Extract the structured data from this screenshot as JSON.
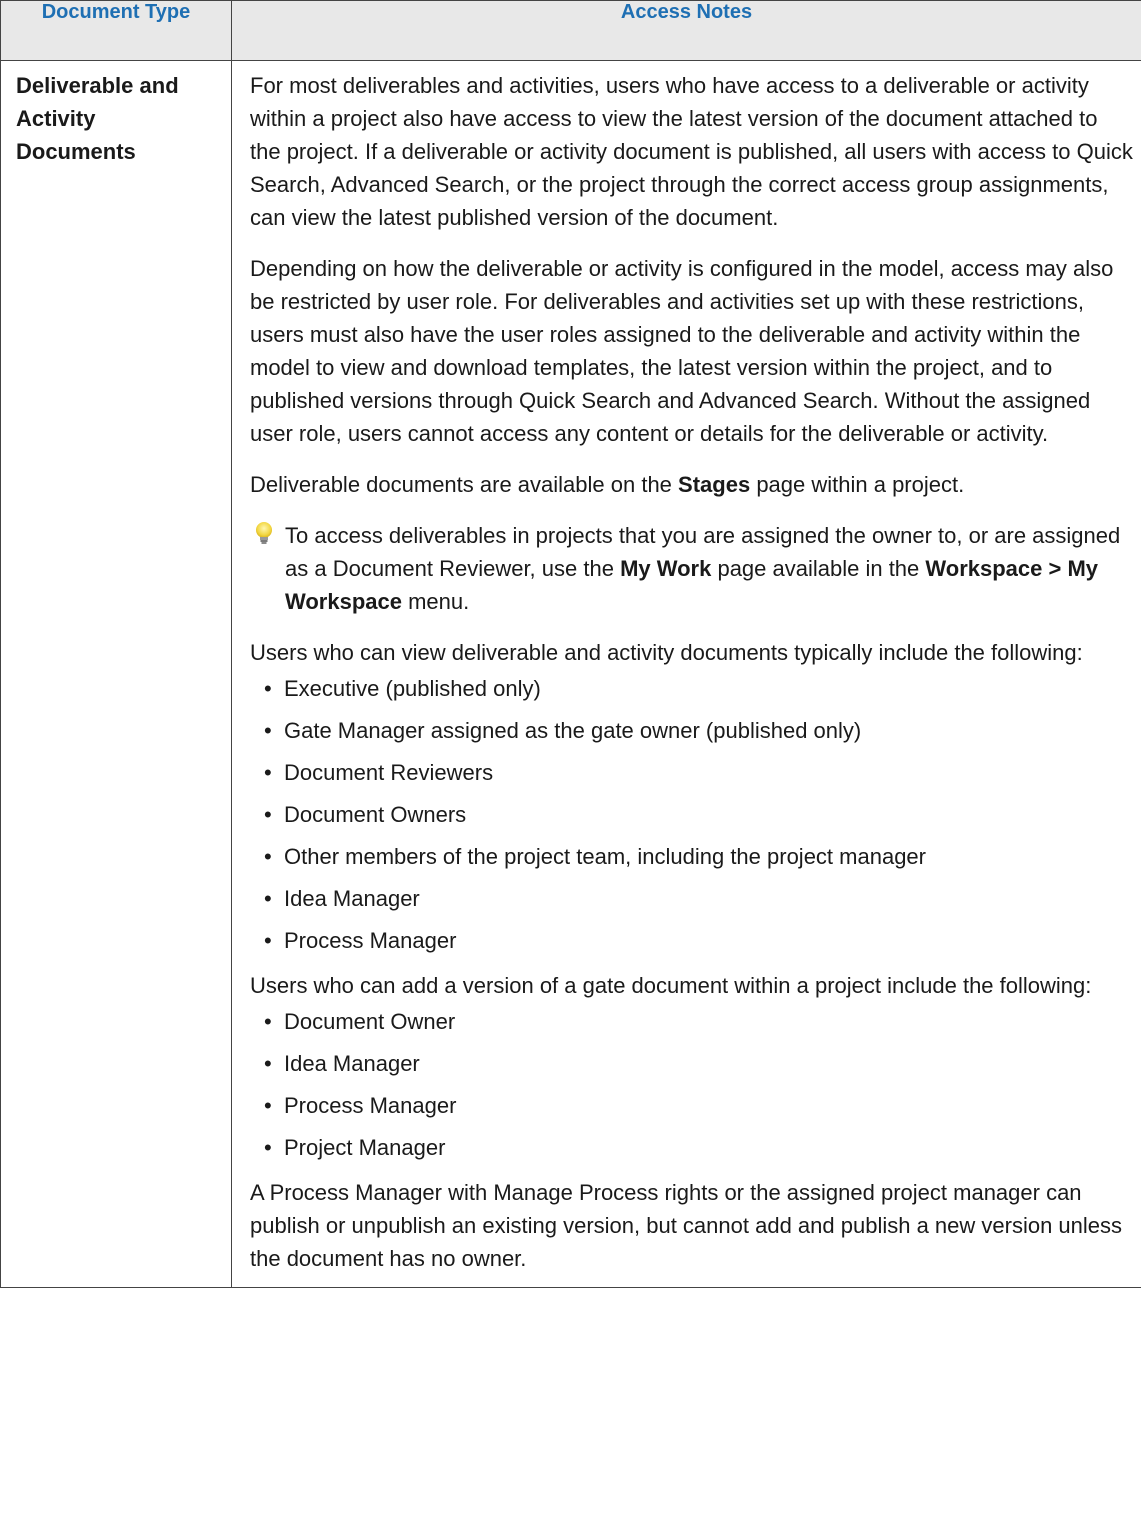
{
  "header": {
    "col1": "Document Type",
    "col2": "Access Notes"
  },
  "row": {
    "type_label": "Deliverable and Activity Documents",
    "p1": "For most deliverables and activities, users who have access to a deliverable or activity within a project also have access to view the latest version of the document attached to the project. If a deliverable or activity document is published, all users with access to Quick Search, Advanced Search, or the project through the correct access group assignments, can view the latest published version of the document.",
    "p2": "Depending on how the deliverable or activity is configured in the model, access may also be restricted by user role. For deliverables and activities set up with these restrictions, users must also have the user roles assigned to the deliverable and activity within the model to view and download templates, the latest version within the project, and to published versions through Quick Search and Advanced Search. Without the assigned user role, users cannot access any content or details for the deliverable or activity.",
    "p3": {
      "before": "Deliverable documents are available on the ",
      "bold": "Stages",
      "after": " page within a project."
    },
    "tip": {
      "icon": "lightbulb-icon",
      "t1": "To access deliverables in projects that you are assigned the owner to, or are assigned as a Document Reviewer, use the ",
      "b1": "My Work",
      "t2": " page available in the ",
      "b2": "Workspace > My Workspace",
      "t3": " menu."
    },
    "view_intro": "Users who can view deliverable and activity documents typically include the following:",
    "view_list": [
      "Executive (published only)",
      "Gate Manager assigned as the gate owner (published only)",
      "Document Reviewers",
      "Document Owners",
      "Other members of the project team, including the project manager",
      "Idea Manager",
      "Process Manager"
    ],
    "add_intro": "Users who can add a version of a gate document within a project include the following:",
    "add_list": [
      "Document Owner",
      "Idea Manager",
      "Process Manager",
      "Project Manager"
    ],
    "final": "A Process Manager with Manage Process rights or the assigned project manager can publish or unpublish an existing version, but cannot add and publish a new version unless the document has no owner."
  },
  "colors": {
    "header_text": "#1e6fb3",
    "header_bg": "#e8e8e8",
    "border": "#444444",
    "bulb_glow": "#f2d640"
  },
  "bullet_glyph": "•"
}
